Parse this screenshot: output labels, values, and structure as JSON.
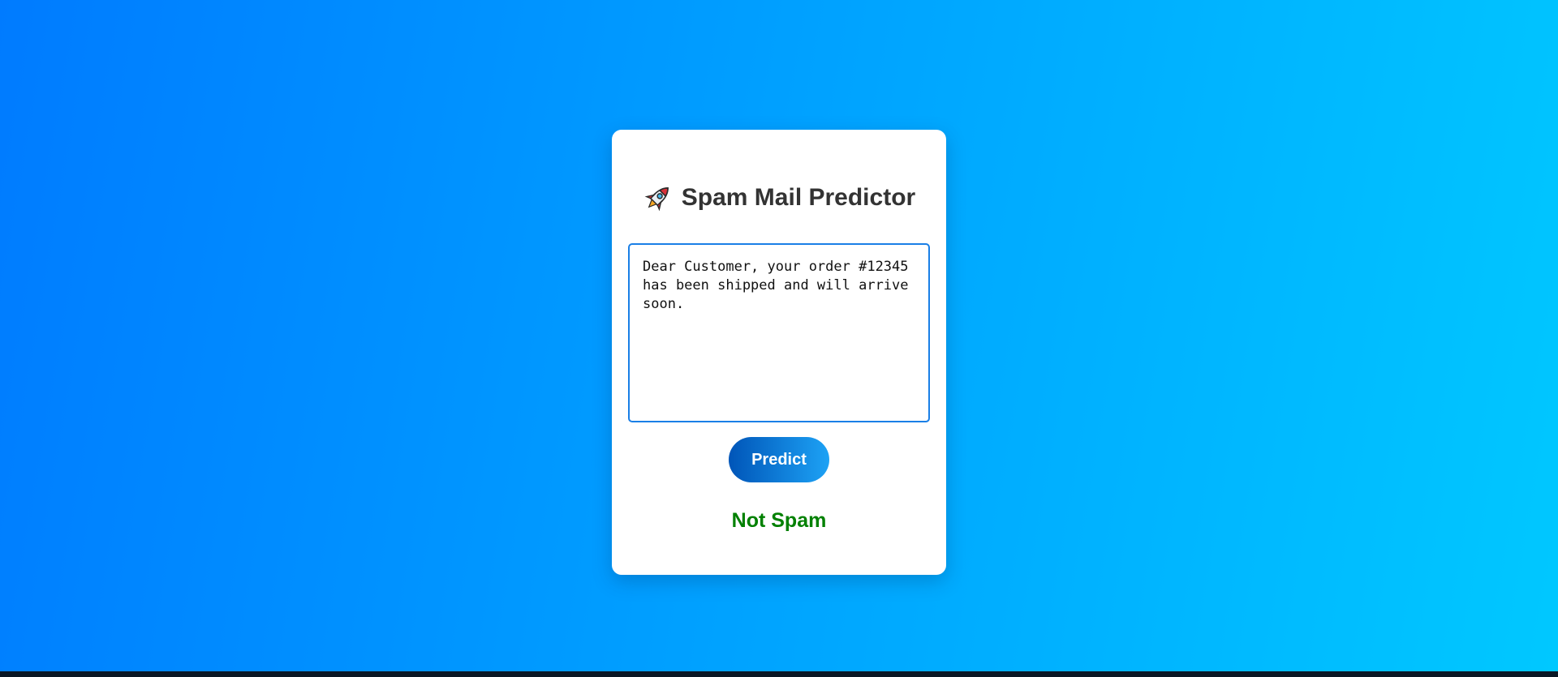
{
  "app": {
    "title": "Spam Mail Predictor",
    "title_icon": "rocket-icon"
  },
  "form": {
    "message_value": "Dear Customer, your order #12345 has been shipped and will arrive soon.",
    "predict_label": "Predict"
  },
  "result": {
    "label": "Not Spam",
    "color": "#008000"
  },
  "colors": {
    "background_start": "#007bff",
    "background_end": "#00c8ff",
    "accent": "#1a7fe6",
    "title_text": "#333333"
  }
}
